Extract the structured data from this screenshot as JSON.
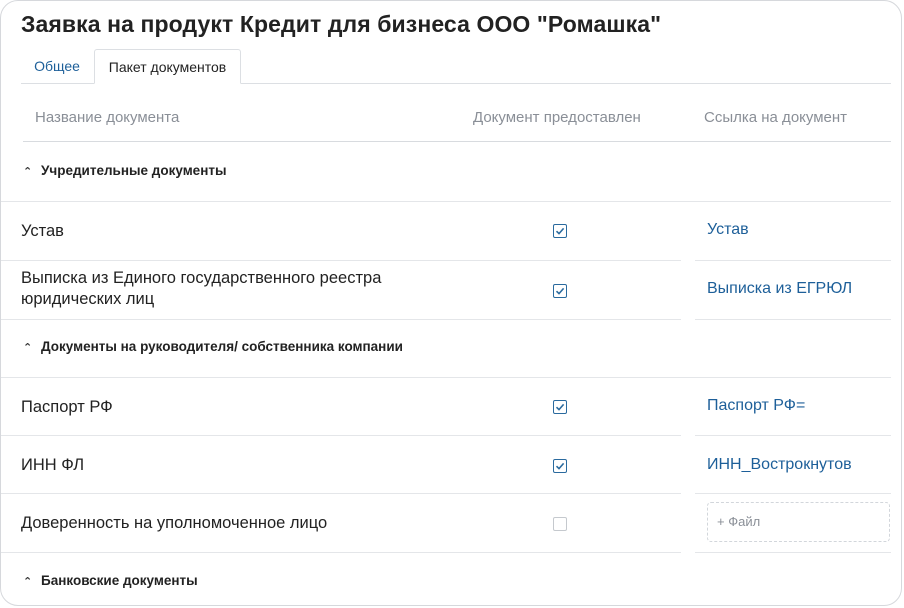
{
  "page": {
    "title": "Заявка на продукт Кредит для бизнеса ООО \"Ромашка\""
  },
  "tabs": [
    {
      "label": "Общее",
      "active": false
    },
    {
      "label": "Пакет документов",
      "active": true
    }
  ],
  "table": {
    "headers": {
      "name": "Название документа",
      "provided": "Документ предоставлен",
      "link": "Ссылка на документ"
    },
    "sections": [
      {
        "title": "Учредительные документы",
        "expanded": true,
        "rows": [
          {
            "name": "Устав",
            "provided": true,
            "link": "Устав"
          },
          {
            "name": "Выписка из Единого государственного реестра юридических лиц",
            "provided": true,
            "link": "Выписка из ЕГРЮЛ"
          }
        ]
      },
      {
        "title": "Документы на руководителя/ собственника компании",
        "expanded": true,
        "rows": [
          {
            "name": "Паспорт РФ",
            "provided": true,
            "link": "Паспорт РФ="
          },
          {
            "name": "ИНН ФЛ",
            "provided": true,
            "link": "ИНН_Вострокнутов"
          },
          {
            "name": "Доверенность на уполномоченное лицо",
            "provided": false,
            "upload_label": "+ Файл"
          }
        ]
      },
      {
        "title": "Банковские документы",
        "expanded": true,
        "rows": []
      }
    ]
  },
  "colors": {
    "accent": "#1d5f99",
    "muted_text": "#8a8f97",
    "divider": "#e4e6e9"
  },
  "icons": {
    "section_toggle": "chevron-up-icon",
    "checked": "checkmark-icon"
  }
}
